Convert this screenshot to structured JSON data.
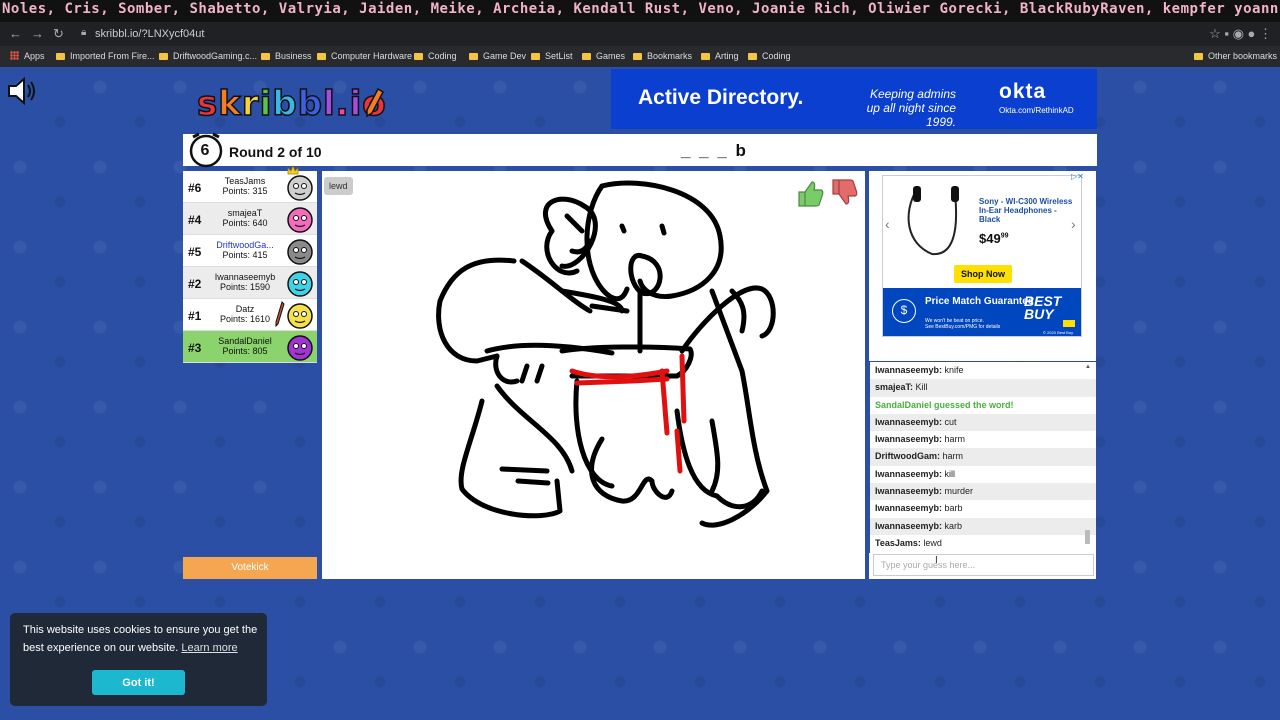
{
  "browser": {
    "tab_marquee": "Noles, Cris, Somber, Shabetto, Valryia, Jaiden, Meike, Archeia, Kendall Rust, Veno, Joanie Rich, Oliwier Gorecki, BlackRubyRaven, kempfer yoann, William Monroe, Gary Clarke, Kemsyn, Rattingham Studios, Hum",
    "url": "skribbl.io/?LNXycf04ut",
    "bookmarks": [
      "Apps",
      "Imported From Fire...",
      "DriftwoodGaming.c...",
      "Business",
      "Computer Hardware",
      "Coding",
      "Game Dev",
      "SetList",
      "Games",
      "Bookmarks",
      "Arting",
      "Coding"
    ],
    "other_bookmarks": "Other bookmarks"
  },
  "logo": {
    "text": "skribbl.io"
  },
  "ad_top": {
    "title": "Active Directory.",
    "tagline": "Keeping admins up all night since 1999.",
    "brand": "okta",
    "url": "Okta.com/RethinkAD"
  },
  "game": {
    "timer": "6",
    "round": "Round 2 of 10",
    "word_hint": "_ _ _ b",
    "guess_bubble": "lewd",
    "votekick_label": "Votekick"
  },
  "players": [
    {
      "rank": "#6",
      "name": "TeasJams",
      "points": "Points: 315",
      "color": "#cfcfcf"
    },
    {
      "rank": "#4",
      "name": "smajeaT",
      "points": "Points: 640",
      "color": "#f26bbd"
    },
    {
      "rank": "#5",
      "name": "DriftwoodGa...",
      "points": "Points: 415",
      "color": "#8a8a8a"
    },
    {
      "rank": "#2",
      "name": "Iwannaseemyb",
      "points": "Points: 1590",
      "color": "#3fd3e8"
    },
    {
      "rank": "#1",
      "name": "Datz",
      "points": "Points: 1610",
      "color": "#f5e24a"
    },
    {
      "rank": "#3",
      "name": "SandalDaniel",
      "points": "Points: 805",
      "color": "#a234d4"
    }
  ],
  "ad_side": {
    "product": "Sony - WI-C300 Wireless In-Ear Headphones - Black",
    "price_main": "$49",
    "price_cents": "99",
    "shop_label": "Shop Now",
    "banner_title": "Price Match Guarantee",
    "banner_sub": "We won't be beat on price.",
    "banner_fine": "See BestBuy.com/PMG for details",
    "brand": "BEST BUY",
    "copyright": "© 2020 Best Buy"
  },
  "chat": [
    {
      "user": "Iwannaseemyb:",
      "text": "knife"
    },
    {
      "user": "smajeaT:",
      "text": "Kill"
    },
    {
      "system": "SandalDaniel guessed the word!"
    },
    {
      "user": "Iwannaseemyb:",
      "text": "cut"
    },
    {
      "user": "Iwannaseemyb:",
      "text": "harm"
    },
    {
      "user": "DriftwoodGam:",
      "text": "harm"
    },
    {
      "user": "Iwannaseemyb:",
      "text": "kill"
    },
    {
      "user": "Iwannaseemyb:",
      "text": "murder"
    },
    {
      "user": "Iwannaseemyb:",
      "text": "barb"
    },
    {
      "user": "Iwannaseemyb:",
      "text": "karb"
    },
    {
      "user": "TeasJams:",
      "text": "lewd"
    }
  ],
  "chat_input": {
    "placeholder": "Type your guess here..."
  },
  "cookie": {
    "text": "This website uses cookies to ensure you get the best experience on our website.",
    "link": "Learn more",
    "button": "Got it!"
  },
  "colors": {
    "accent": "#f5a651",
    "background": "#2b4fa4",
    "me_highlight": "#8bd36c",
    "guessed": "#46b23c",
    "cookie_btn": "#1cb8cf"
  }
}
